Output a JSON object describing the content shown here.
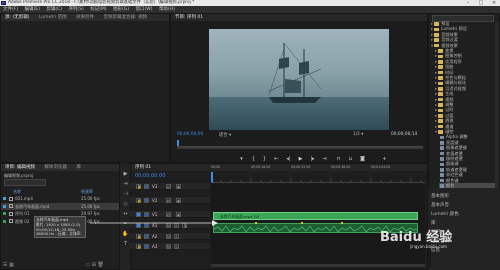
{
  "window": {
    "title": "Adobe Premiere Pro CC 2018 - F:\\素材\\动画电影视频剪辑基础文件（实验）\\编辑视频.prproj *"
  },
  "menu": [
    "文件(F)",
    "编辑(E)",
    "剪辑(C)",
    "序列(S)",
    "标记(M)",
    "图形(G)",
    "窗口(W)",
    "帮助(H)"
  ],
  "top_left_tabs": [
    "源: (无剪辑)",
    "Lumetri 范围",
    "效果控件",
    "音频剪辑混合器: 视频"
  ],
  "source_label": "(无剪辑)",
  "program": {
    "tab": "节目: 序列 01",
    "timecode_left": "00;00;00;00",
    "fit": "适合",
    "ratio": "1/2",
    "timecode_right": "00;00;06;14"
  },
  "effects": {
    "items": [
      {
        "label": "预设",
        "level": 0,
        "expanded": false
      },
      {
        "label": "Lumetri 预设",
        "level": 0,
        "expanded": false
      },
      {
        "label": "音频效果",
        "level": 0,
        "expanded": false
      },
      {
        "label": "音频过渡",
        "level": 0,
        "expanded": false
      },
      {
        "label": "视频效果",
        "level": 0,
        "expanded": true
      },
      {
        "label": "变换",
        "level": 1,
        "expanded": false
      },
      {
        "label": "图像控制",
        "level": 1,
        "expanded": false
      },
      {
        "label": "实用程序",
        "level": 1,
        "expanded": false
      },
      {
        "label": "扭曲",
        "level": 1,
        "expanded": false
      },
      {
        "label": "时间",
        "level": 1,
        "expanded": false
      },
      {
        "label": "杂色与颗粒",
        "level": 1,
        "expanded": false
      },
      {
        "label": "模糊与锐化",
        "level": 1,
        "expanded": false
      },
      {
        "label": "沉浸式视频",
        "level": 1,
        "expanded": false
      },
      {
        "label": "生成",
        "level": 1,
        "expanded": false
      },
      {
        "label": "视频",
        "level": 1,
        "expanded": false
      },
      {
        "label": "调整",
        "level": 1,
        "expanded": false
      },
      {
        "label": "过时",
        "level": 1,
        "expanded": false
      },
      {
        "label": "过渡",
        "level": 1,
        "expanded": false
      },
      {
        "label": "透视",
        "level": 1,
        "expanded": false
      },
      {
        "label": "通道",
        "level": 1,
        "expanded": false
      },
      {
        "label": "键控",
        "level": 1,
        "expanded": true
      },
      {
        "label": "Alpha 调整",
        "level": 2,
        "expanded": false
      },
      {
        "label": "亮度键",
        "level": 2,
        "expanded": false
      },
      {
        "label": "图像遮罩键",
        "level": 2,
        "expanded": false
      },
      {
        "label": "差值遮罩",
        "level": 2,
        "expanded": false
      },
      {
        "label": "移除遮罩",
        "level": 2,
        "expanded": false
      },
      {
        "label": "超级键",
        "level": 2,
        "expanded": false
      },
      {
        "label": "轨道遮罩键",
        "level": 2,
        "expanded": false
      },
      {
        "label": "非红色键",
        "level": 2,
        "expanded": false
      },
      {
        "label": "颜色键",
        "level": 2,
        "expanded": false
      },
      {
        "label": "颜色",
        "level": 2,
        "expanded": false,
        "selected": true
      },
      {
        "label": "风格化",
        "level": 1,
        "expanded": false
      },
      {
        "label": "视频过渡",
        "level": 0,
        "expanded": false
      }
    ],
    "bottom_panels": [
      "基本图形",
      "基本声音",
      "Lumetri 颜色",
      "库",
      "标记",
      "历史记录",
      "信息"
    ]
  },
  "project": {
    "tabs": [
      "项目: 编辑视频",
      "媒体浏览器",
      "库",
      "信息"
    ],
    "file": "编辑视频.prproj",
    "col_name": "名称",
    "col_rate": "帧速率",
    "rows": [
      {
        "name": "001.mp4",
        "rate": "25.00 fps",
        "color": "#4a9fd6"
      },
      {
        "name": "去除汽车画面.mp4",
        "rate": "25.00 fps",
        "color": "#4a9fd6",
        "selected": true
      },
      {
        "name": "序列 01",
        "rate": "29.97 fps",
        "color": "#2fa84f"
      },
      {
        "name": "视频 02",
        "rate": "25.00 fps",
        "color": "#2fa84f"
      }
    ],
    "tooltip": [
      "去除汽车画面.mp4",
      "影片, 1920 x 1080 (1.0)",
      "00;00;21;16, 25.00p",
      "48000 Hz - 压缩 - 立体声"
    ]
  },
  "timeline": {
    "tab": "序列 01",
    "timecode": "00;00;00;00",
    "video_tracks": [
      "V3",
      "V2",
      "V1"
    ],
    "audio_tracks": [
      "A1",
      "A2",
      "A3"
    ],
    "clip_label": "去除汽车画面.mp4 [V]",
    "ruler_labels": [
      "00;00",
      "00;00;16;00",
      "00;00;32;00",
      "00;00;48;00",
      "00;01;04;02"
    ]
  },
  "watermark": "Baidu 经验",
  "watermark_sub": "jingyan.baidu.com",
  "colors": {
    "accent": "#2d8ceb",
    "clip_green": "#3aa655",
    "audio_green": "#2f8f4a"
  }
}
